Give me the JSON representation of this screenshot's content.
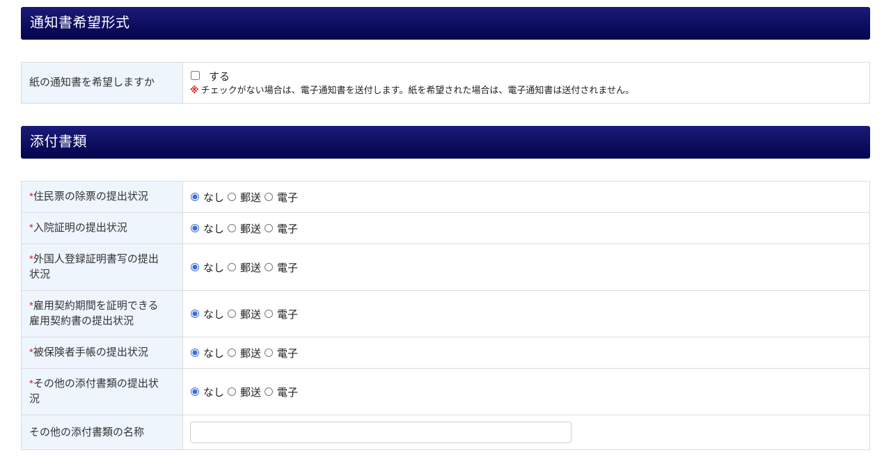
{
  "notice": {
    "title": "通知書希望形式",
    "paper_label": "紙の通知書を希望しますか",
    "paper_option": "する",
    "paper_checked": false,
    "note_mark": "※",
    "note_text": "チェックがない場合は、電子通知書を送付します。紙を希望された場合は、電子通知書は送付されません。"
  },
  "attachments": {
    "title": "添付書類",
    "required_mark": "*",
    "options": [
      "なし",
      "郵送",
      "電子"
    ],
    "rows": [
      {
        "label": "住民票の除票の提出状況",
        "required": true,
        "selected": "なし"
      },
      {
        "label": "入院証明の提出状況",
        "required": true,
        "selected": "なし"
      },
      {
        "label": "外国人登録証明書写の提出状況",
        "required": true,
        "selected": "なし"
      },
      {
        "label": "雇用契約期間を証明できる雇用契約書の提出状況",
        "required": true,
        "selected": "なし"
      },
      {
        "label": "被保険者手帳の提出状況",
        "required": true,
        "selected": "なし"
      },
      {
        "label": "その他の添付書類の提出状況",
        "required": true,
        "selected": "なし"
      }
    ],
    "other_name_label": "その他の添付書類の名称",
    "other_name_value": ""
  },
  "colors": {
    "header_bg": "#03034d",
    "label_bg": "#eef5fd",
    "required": "#e02020",
    "radio_accent": "#3a6fd8"
  }
}
